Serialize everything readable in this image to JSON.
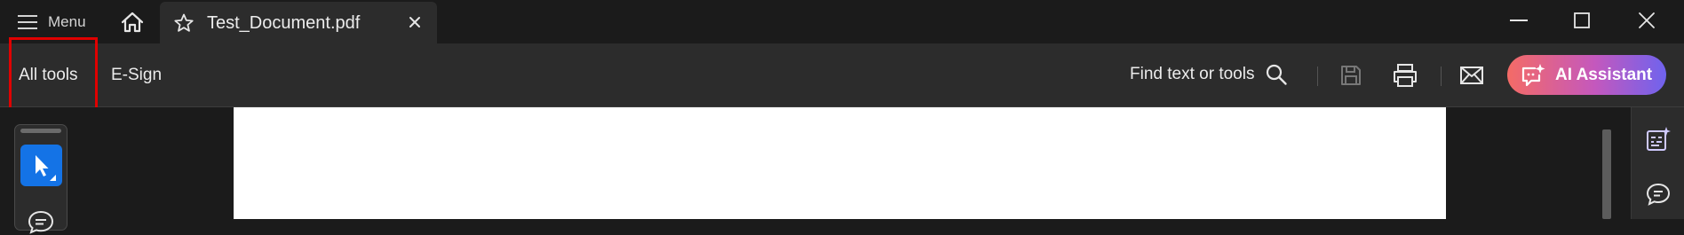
{
  "titlebar": {
    "menu_label": "Menu",
    "home_icon": "home-icon",
    "tab": {
      "title": "Test_Document.pdf",
      "star_icon": "star-icon",
      "close_icon": "close-icon"
    },
    "window_controls": [
      "minimize-icon",
      "maximize-icon",
      "close-icon"
    ]
  },
  "toolbar": {
    "nav": [
      "All tools",
      "E-Sign"
    ],
    "find_label": "Find text or tools",
    "icons": [
      "search-icon",
      "save-icon",
      "print-icon",
      "mail-icon"
    ],
    "ai_label": "AI Assistant",
    "ai_gradient": [
      "#f46b66",
      "#c458bd",
      "#6f63ee"
    ]
  },
  "annotation": {
    "highlight_color": "#e00000",
    "highlighted_item": "All tools"
  },
  "left_tools": {
    "active_tool": "select-cursor-icon",
    "next_tool": "comment-icon",
    "active_color": "#1473e6"
  },
  "right_rail": {
    "icons": [
      "ai-summary-icon",
      "comment-bubble-icon"
    ]
  }
}
